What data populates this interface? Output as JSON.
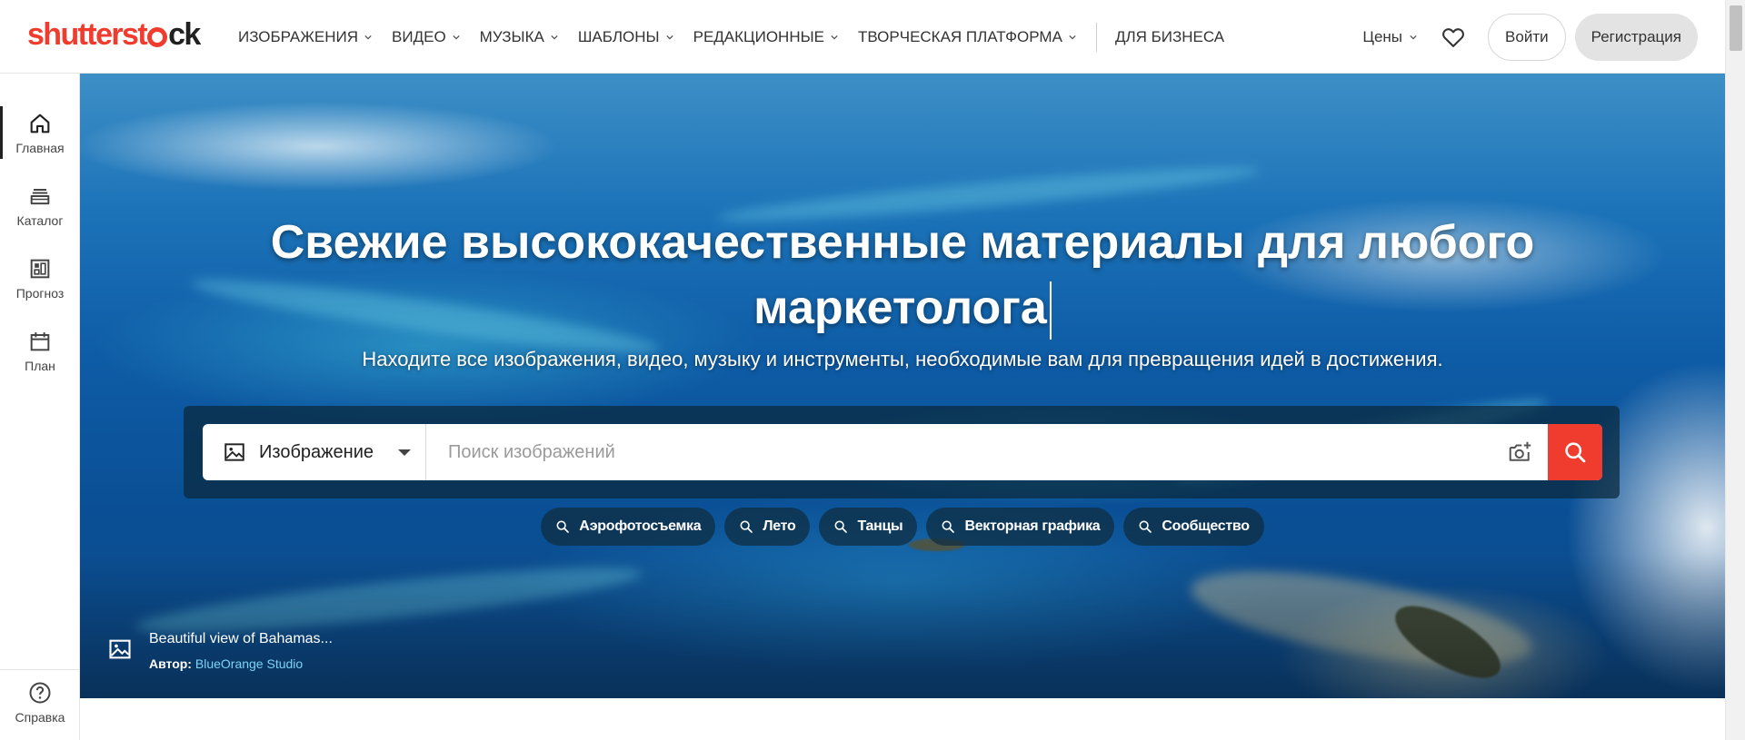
{
  "brand": {
    "logo_pre": "shutterst",
    "logo_post": "ck",
    "accent": "#f03c2e"
  },
  "nav": {
    "items": [
      {
        "label": "ИЗОБРАЖЕНИЯ",
        "has_dropdown": true
      },
      {
        "label": "ВИДЕО",
        "has_dropdown": true
      },
      {
        "label": "МУЗЫКА",
        "has_dropdown": true
      },
      {
        "label": "ШАБЛОНЫ",
        "has_dropdown": true
      },
      {
        "label": "РЕДАКЦИОННЫЕ",
        "has_dropdown": true
      },
      {
        "label": "ТВОРЧЕСКАЯ ПЛАТФОРМА",
        "has_dropdown": true
      }
    ],
    "business": "ДЛЯ БИЗНЕСА",
    "prices": "Цены",
    "login": "Войти",
    "register": "Регистрация"
  },
  "rail": {
    "items": [
      {
        "label": "Главная",
        "icon": "home-icon",
        "active": true
      },
      {
        "label": "Каталог",
        "icon": "catalog-icon",
        "active": false
      },
      {
        "label": "Прогноз",
        "icon": "forecast-icon",
        "active": false
      },
      {
        "label": "План",
        "icon": "calendar-icon",
        "active": false
      }
    ],
    "help": "Справка"
  },
  "hero": {
    "title_line1": "Свежие высококачественные материалы для любого",
    "title_line2": "маркетолога",
    "subtitle": "Находите все изображения, видео, музыку и инструменты, необходимые вам для превращения идей в достижения.",
    "search": {
      "type": "Изображение",
      "placeholder": "Поиск изображений",
      "value": ""
    },
    "chips": [
      "Аэрофотосъемка",
      "Лето",
      "Танцы",
      "Векторная графика",
      "Сообщество"
    ],
    "credit": {
      "title": "Beautiful view of Bahamas...",
      "author_label": "Автор:",
      "author": "BlueOrange Studio"
    }
  }
}
